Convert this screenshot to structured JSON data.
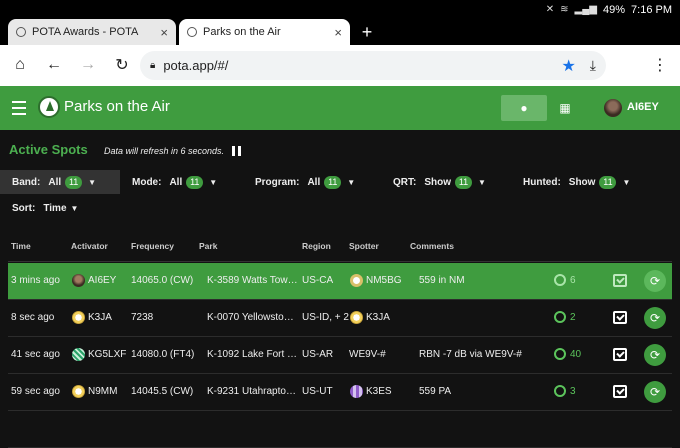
{
  "status": {
    "battery": "49%",
    "time": "7:16 PM"
  },
  "tabs": [
    {
      "title": "POTA Awards - POTA",
      "close": "×"
    },
    {
      "title": "Parks on the Air",
      "close": "×"
    }
  ],
  "new_tab": "+",
  "url": "pota.app/#/",
  "app": {
    "title": "Parks on the Air",
    "user": "AI6EY"
  },
  "section": {
    "title": "Active Spots",
    "refresh": "Data will refresh in 6 seconds."
  },
  "filters": {
    "band": {
      "label": "Band:",
      "value": "All",
      "count": "11"
    },
    "mode": {
      "label": "Mode:",
      "value": "All",
      "count": "11"
    },
    "program": {
      "label": "Program:",
      "value": "All",
      "count": "11"
    },
    "qrt": {
      "label": "QRT:",
      "value": "Show",
      "count": "11"
    },
    "hunted": {
      "label": "Hunted:",
      "value": "Show",
      "count": "11"
    },
    "sort": {
      "label": "Sort:",
      "value": "Time"
    }
  },
  "columns": [
    "Time",
    "Activator",
    "Frequency",
    "Park",
    "Region",
    "Spotter",
    "Comments"
  ],
  "rows": [
    {
      "time": "3 mins ago",
      "activator": "AI6EY",
      "frequency": "14065.0 (CW)",
      "park": "K-3589  Watts Tow…",
      "region": "US-CA",
      "spotter": "NM5BG",
      "comment": "559 in NM",
      "hunted": "6"
    },
    {
      "time": "8 sec ago",
      "activator": "K3JA",
      "frequency": "7238",
      "park": "K-0070  Yellowsto…",
      "region": "US-ID, + 2",
      "spotter": "K3JA",
      "comment": "",
      "hunted": "2"
    },
    {
      "time": "41 sec ago",
      "activator": "KG5LXF",
      "frequency": "14080.0 (FT4)",
      "park": "K-1092  Lake Fort …",
      "region": "US-AR",
      "spotter": "WE9V-#",
      "comment": "RBN -7 dB via WE9V-#",
      "hunted": "40"
    },
    {
      "time": "59 sec ago",
      "activator": "N9MM",
      "frequency": "14045.5 (CW)",
      "park": "K-9231  Utahrapto…",
      "region": "US-UT",
      "spotter": "K3ES",
      "comment": "559 PA",
      "hunted": "3"
    }
  ]
}
